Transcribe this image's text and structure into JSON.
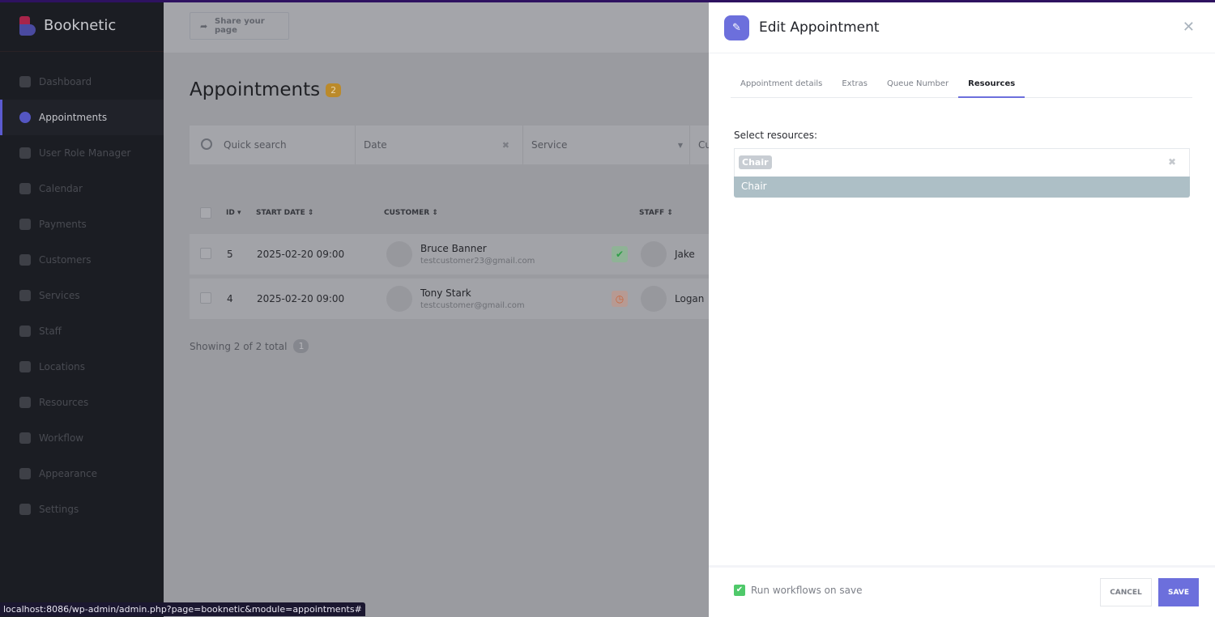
{
  "app": {
    "name": "Booknetic"
  },
  "sidebar": {
    "items": [
      {
        "label": "Dashboard",
        "icon": "cube-icon"
      },
      {
        "label": "Appointments",
        "icon": "clock-icon",
        "active": true
      },
      {
        "label": "User Role Manager",
        "icon": "user-plus-icon"
      },
      {
        "label": "Calendar",
        "icon": "calendar-icon"
      },
      {
        "label": "Payments",
        "icon": "credit-card-icon"
      },
      {
        "label": "Customers",
        "icon": "users-icon"
      },
      {
        "label": "Services",
        "icon": "list-icon"
      },
      {
        "label": "Staff",
        "icon": "user-icon"
      },
      {
        "label": "Locations",
        "icon": "location-arrow-icon"
      },
      {
        "label": "Resources",
        "icon": "building-icon"
      },
      {
        "label": "Workflow",
        "icon": "workflow-icon"
      },
      {
        "label": "Appearance",
        "icon": "brush-icon"
      },
      {
        "label": "Settings",
        "icon": "gear-icon"
      }
    ]
  },
  "header": {
    "share_label": "Share your page"
  },
  "page": {
    "title": "Appointments",
    "count": "2"
  },
  "filters": {
    "search_placeholder": "Quick search",
    "date_placeholder": "Date",
    "service_placeholder": "Service",
    "next_partial": "Cu"
  },
  "table": {
    "headers": {
      "id": "ID",
      "start_date": "START DATE",
      "customer": "CUSTOMER",
      "staff": "STAFF"
    },
    "rows": [
      {
        "id": "5",
        "start": "2025-02-20 09:00",
        "customer": "Bruce Banner",
        "email": "testcustomer23@gmail.com",
        "status": "approved",
        "status_icon": "✔",
        "staff": "Jake"
      },
      {
        "id": "4",
        "start": "2025-02-20 09:00",
        "customer": "Tony Stark",
        "email": "testcustomer@gmail.com",
        "status": "pending",
        "status_icon": "◷",
        "staff": "Logan"
      }
    ]
  },
  "pagination": {
    "showing": "Showing 2 of 2 total",
    "page": "1"
  },
  "modal": {
    "title": "Edit Appointment",
    "tabs": [
      "Appointment details",
      "Extras",
      "Queue Number",
      "Resources"
    ],
    "active_tab": "Resources",
    "resources_label": "Select resources:",
    "selected_chip": "Chair",
    "dropdown_option": "Chair",
    "run_workflows_label": "Run workflows on save",
    "run_workflows_checked": true,
    "cancel_label": "CANCEL",
    "save_label": "SAVE"
  },
  "status_bar": {
    "url": "localhost:8086/wp-admin/admin.php?page=booknetic&module=appointments#"
  },
  "colors": {
    "accent": "#6c6fdc",
    "approved": "#4fc96a",
    "pending": "#e0703a"
  }
}
